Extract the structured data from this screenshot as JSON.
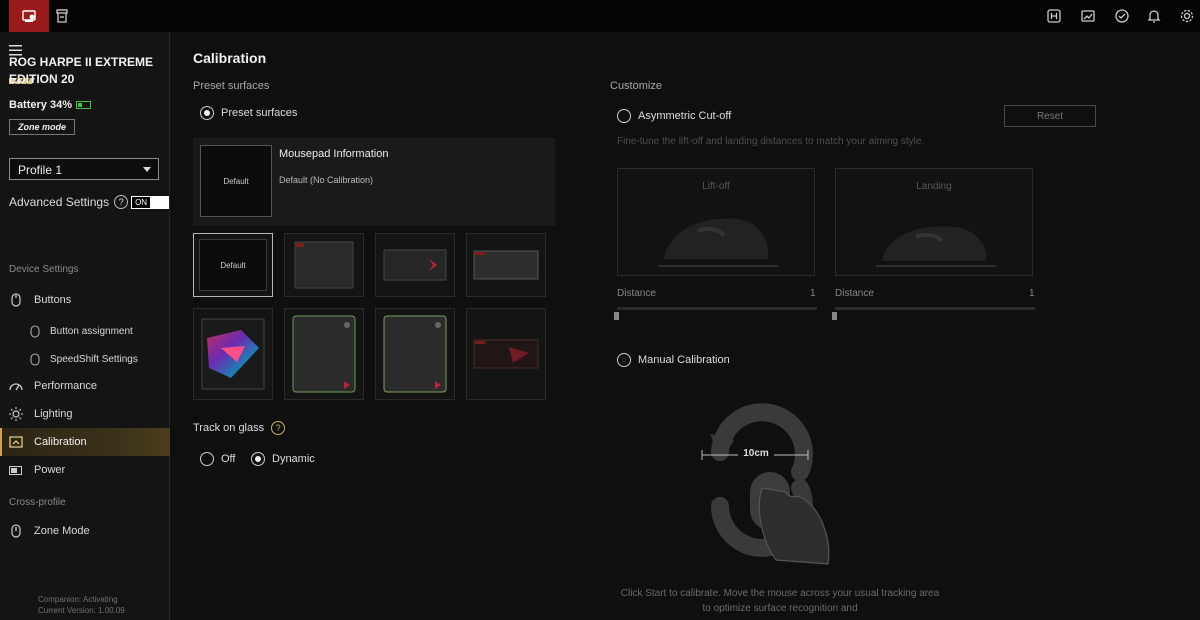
{
  "topbar": {
    "tabs": [
      {
        "icon": "device-icon",
        "active": true
      },
      {
        "icon": "inventory-icon",
        "active": false
      }
    ],
    "right_icons": [
      "hotkey-icon",
      "screenshot-icon",
      "update-icon",
      "notification-icon",
      "settings-icon"
    ]
  },
  "sidebar": {
    "menu_icon": "hamburger-menu-icon",
    "device_name": "ROG HARPE II EXTREME EDITION 20",
    "battery": "Battery 34%",
    "zone_mode_button": "Zone mode",
    "profile": "Profile 1",
    "advanced_settings_label": "Advanced Settings",
    "advanced_settings_value": "ON",
    "device_settings_label": "Device Settings",
    "items": {
      "buttons": "Buttons",
      "button_assignment": "Button assignment",
      "speedshift": "SpeedShift Settings",
      "performance": "Performance",
      "lighting": "Lighting",
      "calibration": "Calibration",
      "power": "Power"
    },
    "cross_profile_label": "Cross-profile",
    "zone_mode": "Zone Mode",
    "footer": {
      "companion": "Companion: Activating",
      "version": "Current Version: 1.00.09"
    }
  },
  "main": {
    "title": "Calibration",
    "preset_surfaces_heading": "Preset surfaces",
    "preset_surfaces_option": "Preset surfaces",
    "mousepad_info_title": "Mousepad Information",
    "mousepad_info_value": "Default (No Calibration)",
    "default_thumb_label": "Default",
    "tiles": [
      "Default",
      "",
      "",
      "",
      "",
      "",
      "",
      ""
    ],
    "track_on_glass_label": "Track on glass",
    "track_options": {
      "off": "Off",
      "dynamic": "Dynamic"
    },
    "track_selected": "Dynamic"
  },
  "customize": {
    "heading": "Customize",
    "asymmetric_label": "Asymmetric Cut-off",
    "reset_label": "Reset",
    "description": "Fine-tune the lift-off and landing distances to match your aiming style.",
    "liftoff_label": "Lift-off",
    "landing_label": "Landing",
    "distance_label": "Distance",
    "liftoff_distance": "1",
    "landing_distance": "1",
    "manual_label": "Manual Calibration",
    "distance_marker": "10cm",
    "instruction": "Click Start to calibrate. Move the mouse across your usual tracking area to optimize surface recognition and"
  },
  "colors": {
    "accent_red": "#9a1b1b",
    "active_gold": "#c9a24a",
    "battery_green": "#3ec24a"
  }
}
